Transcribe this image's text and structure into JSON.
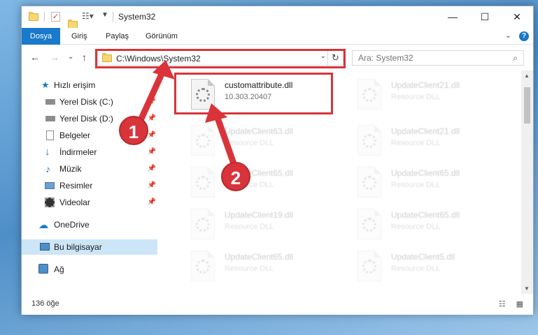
{
  "window": {
    "title": "System32"
  },
  "window_controls": {
    "minimize": "—",
    "maximize": "☐",
    "close": "✕"
  },
  "ribbon": {
    "tabs": [
      "Dosya",
      "Giriş",
      "Paylaş",
      "Görünüm"
    ],
    "collapse_glyph": "⌄",
    "help_glyph": "?"
  },
  "nav": {
    "back": "←",
    "forward": "→",
    "recent": "⌄",
    "up": "↑"
  },
  "address": {
    "path": "C:\\Windows\\System32",
    "dropdown": "⌄",
    "refresh": "↻"
  },
  "search": {
    "placeholder": "Ara: System32",
    "icon": "⌕"
  },
  "sidebar": {
    "items": [
      {
        "label": "Hızlı erişim",
        "icon": "star-icon"
      },
      {
        "label": "Yerel Disk (C:)",
        "icon": "drive-icon"
      },
      {
        "label": "Yerel Disk (D:)",
        "icon": "drive-icon"
      },
      {
        "label": "Belgeler",
        "icon": "documents-icon"
      },
      {
        "label": "İndirmeler",
        "icon": "downloads-icon"
      },
      {
        "label": "Müzik",
        "icon": "music-icon"
      },
      {
        "label": "Resimler",
        "icon": "pictures-icon"
      },
      {
        "label": "Videolar",
        "icon": "videos-icon"
      },
      {
        "label": "OneDrive",
        "icon": "cloud-icon"
      },
      {
        "label": "Bu bilgisayar",
        "icon": "computer-icon"
      },
      {
        "label": "Ağ",
        "icon": "network-icon"
      }
    ],
    "pin_glyph": "📌"
  },
  "files": [
    {
      "name": "customattribute.dll",
      "sub": "10.303.20407"
    },
    {
      "name": "UpdateClient21.dll",
      "sub": "Resource DLL"
    },
    {
      "name": "UpdateClient63.dll",
      "sub": "Resource DLL"
    },
    {
      "name": "UpdateClient21.dll",
      "sub": "Resource DLL"
    },
    {
      "name": "UpdateClient65.dll",
      "sub": "Resource DLL"
    },
    {
      "name": "UpdateClient65.dll",
      "sub": "Resource DLL"
    },
    {
      "name": "UpdateClient19.dll",
      "sub": "Resource DLL"
    },
    {
      "name": "UpdateClient65.dll",
      "sub": "Resource DLL"
    },
    {
      "name": "UpdateClient65.dll",
      "sub": "Resource DLL"
    },
    {
      "name": "UpdateClient5.dll",
      "sub": "Resource DLL"
    }
  ],
  "status": {
    "count": "136 öğe",
    "views": "☷ ▦"
  },
  "callouts": [
    "1",
    "2"
  ],
  "colors": {
    "accent": "#1979ca",
    "highlight": "#d9343a",
    "selected": "#cde6f7"
  }
}
